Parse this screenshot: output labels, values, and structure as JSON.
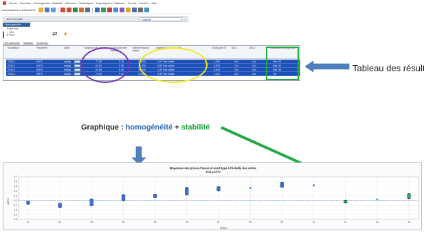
{
  "menubar": {
    "items": [
      "Fichier",
      "Données",
      "Homogénéité / Stabilité",
      "Sélection",
      "Statistiques",
      "Graphiques et Tableaux",
      "Format",
      "Fenêtre",
      "Aide"
    ]
  },
  "toolbar": {
    "label": "Compositions et traitements"
  },
  "document": {
    "name": "Jeux sur pale",
    "combo_value": "Stabilité"
  },
  "section": {
    "title": "Homogénéité"
  },
  "options": {
    "header": "Point fixe",
    "opt1": "Oui",
    "opt2": "Non"
  },
  "tabs": [
    "Homogénéité",
    "Stabilité",
    "Synthèse"
  ],
  "results": {
    "columns": [
      "Échantillon",
      "Paramètre",
      "Unité",
      "Moyenne des mesures",
      "Écart-type entre flacons",
      "Nombre flacons testés",
      "Incertitude de la Stabilité",
      "Écart-type ST",
      "IDS 1",
      "IDS 2",
      "Conclusion homogénéité"
    ],
    "rows": [
      {
        "sample": "2334-1",
        "param": "AH70",
        "unit": "mg/kg",
        "mean": "77.56",
        "sd": "0.19",
        "n": "10.000",
        "unc": "1.07 Pas valide",
        "st": "1,092",
        "c1": "Oui",
        "c2": "Oui",
        "concl": "Pas OK"
      },
      {
        "sample": "2334-2",
        "param": "AH70",
        "unit": "mg/kg",
        "mean": "64.53",
        "sd": "0.38",
        "n": "10.000",
        "unc": "0.85 Pas valide",
        "st": "0,876",
        "c1": "Oui",
        "c2": "Oui",
        "concl": "Pas OK"
      },
      {
        "sample": "2334-3",
        "param": "AH70",
        "unit": "mg/kg",
        "mean": "91.88",
        "sd": "0.25",
        "n": "10.000",
        "unc": "1.34 Pas valide",
        "st": "0,934",
        "c1": "Oui",
        "c2": "Oui",
        "concl": "Pas OK"
      },
      {
        "sample": "2334-4",
        "param": "AH70",
        "unit": "mg/kg",
        "mean": "70.02",
        "sd": "0.41",
        "n": "10.000",
        "unc": "0.96 Pas valide",
        "st": "1,024",
        "c1": "Oui",
        "c2": "Oui",
        "concl": "OK"
      }
    ]
  },
  "annotations": {
    "results_label": "Tableau des résultats",
    "graph_prefix": "Graphique : ",
    "graph_homog": "homogénéité",
    "graph_plus": " + ",
    "graph_stab": "stabilité"
  },
  "colors": {
    "row_selected": "#1c4fb8",
    "homogeneity": "#2e6fb7",
    "stability": "#1fa53a",
    "callout_arrow": "#4f7fbf",
    "purple": "#7a35b8",
    "yellow": "#f3e620"
  },
  "chart_data": {
    "type": "scatter",
    "title": "Moyennes des prises d'essai et écart-type à l'échelle des unités",
    "subtitle": "2334-4 AH70",
    "xlabel": "Unités",
    "ylabel": "AH70",
    "ylim": [
      3.8,
      4.7
    ],
    "yticks": [
      3.8,
      3.9,
      4.0,
      4.1,
      4.2,
      4.3,
      4.4,
      4.5,
      4.6,
      4.7
    ],
    "reference_line": 4.2,
    "categories": [
      "01",
      "02",
      "03",
      "04",
      "05",
      "06",
      "07",
      "08",
      "09",
      "10",
      "11",
      "12",
      "13"
    ],
    "series": [
      {
        "group": "homogeneity",
        "color": "#3d6fd1",
        "ranges": [
          [
            4.12,
            4.18
          ],
          [
            4.05,
            4.14
          ],
          [
            4.09,
            4.23
          ],
          [
            4.2,
            4.32
          ],
          [
            4.26,
            4.33
          ],
          [
            4.32,
            4.47
          ],
          [
            4.4,
            4.49
          ],
          [
            4.46,
            4.46
          ],
          [
            4.48,
            4.58
          ],
          [
            4.52,
            4.52
          ]
        ]
      },
      {
        "group": "stability",
        "color": "#29b34a",
        "ranges": [
          [
            4.15,
            4.2
          ],
          [
            4.22,
            4.22
          ],
          [
            4.24,
            4.34
          ]
        ]
      }
    ]
  }
}
